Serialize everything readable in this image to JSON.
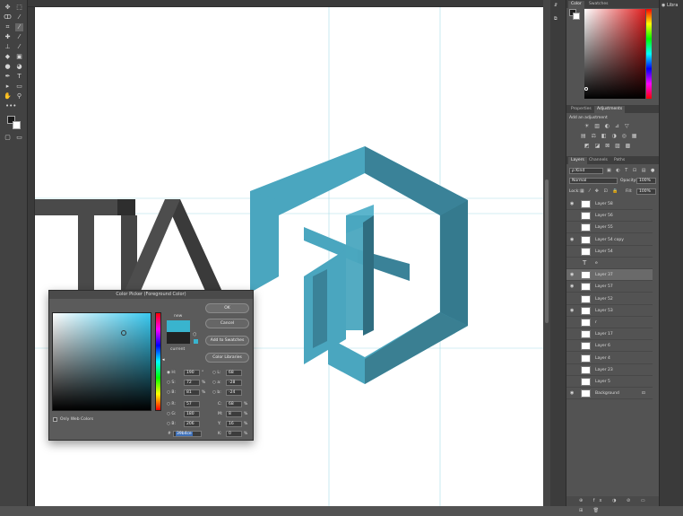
{
  "panels": {
    "color_tabs": [
      "Color",
      "Swatches"
    ],
    "adjust_tabs": [
      "Properties",
      "Adjustments"
    ],
    "add_adjustment": "Add an adjustment",
    "layer_tabs": [
      "Layers",
      "Channels",
      "Paths"
    ],
    "kind": "ρ Kind",
    "blend_mode": "Normal",
    "opacity_label": "Opacity:",
    "opacity_value": "100%",
    "lock_label": "Lock:",
    "fill_label": "Fill:",
    "fill_value": "100%",
    "libraries_tab": "Libra"
  },
  "layers": [
    {
      "name": "Layer 58",
      "visible": true,
      "selected": false
    },
    {
      "name": "Layer 56",
      "visible": false,
      "selected": false
    },
    {
      "name": "Layer 55",
      "visible": false,
      "selected": false
    },
    {
      "name": "Layer 54 copy",
      "visible": true,
      "selected": false
    },
    {
      "name": "Layer 54",
      "visible": false,
      "selected": false
    },
    {
      "name": "e",
      "visible": false,
      "selected": false,
      "type": "text"
    },
    {
      "name": "Layer 37",
      "visible": true,
      "selected": true
    },
    {
      "name": "Layer 57",
      "visible": true,
      "selected": false
    },
    {
      "name": "Layer 52",
      "visible": false,
      "selected": false
    },
    {
      "name": "Layer 53",
      "visible": true,
      "selected": false
    },
    {
      "name": "r",
      "visible": false,
      "selected": false
    },
    {
      "name": "Layer 17",
      "visible": false,
      "selected": false
    },
    {
      "name": "Layer 6",
      "visible": false,
      "selected": false
    },
    {
      "name": "Layer 4",
      "visible": false,
      "selected": false
    },
    {
      "name": "Layer 23",
      "visible": false,
      "selected": false
    },
    {
      "name": "Layer 5",
      "visible": false,
      "selected": false
    },
    {
      "name": "Background",
      "visible": true,
      "selected": false
    }
  ],
  "picker": {
    "title": "Color Picker (Foreground Color)",
    "ok": "OK",
    "cancel": "Cancel",
    "add_swatches": "Add to Swatches",
    "color_libraries": "Color Libraries",
    "new_label": "new",
    "current_label": "current",
    "web_only": "Only Web Colors",
    "hex_prefix": "#",
    "hex": "39b4ce",
    "new_color": "#39b4ce",
    "current_color": "#222222",
    "fields": {
      "H": "190",
      "S": "72",
      "Bv": "81",
      "R": "57",
      "G": "180",
      "Bc": "206",
      "L": "68",
      "a": "-28",
      "b": "-24",
      "C": "68",
      "M": "8",
      "Y": "16",
      "K": "0"
    },
    "units": {
      "H": "°",
      "S": "%",
      "Bv": "%",
      "C": "%",
      "M": "%",
      "Y": "%",
      "K": "%"
    }
  },
  "colors": {
    "brand_teal": "#4aa6bf",
    "brand_teal_dark": "#3a7f92",
    "brand_teal_mid": "#2f6d80",
    "text_gray": "#444444"
  }
}
